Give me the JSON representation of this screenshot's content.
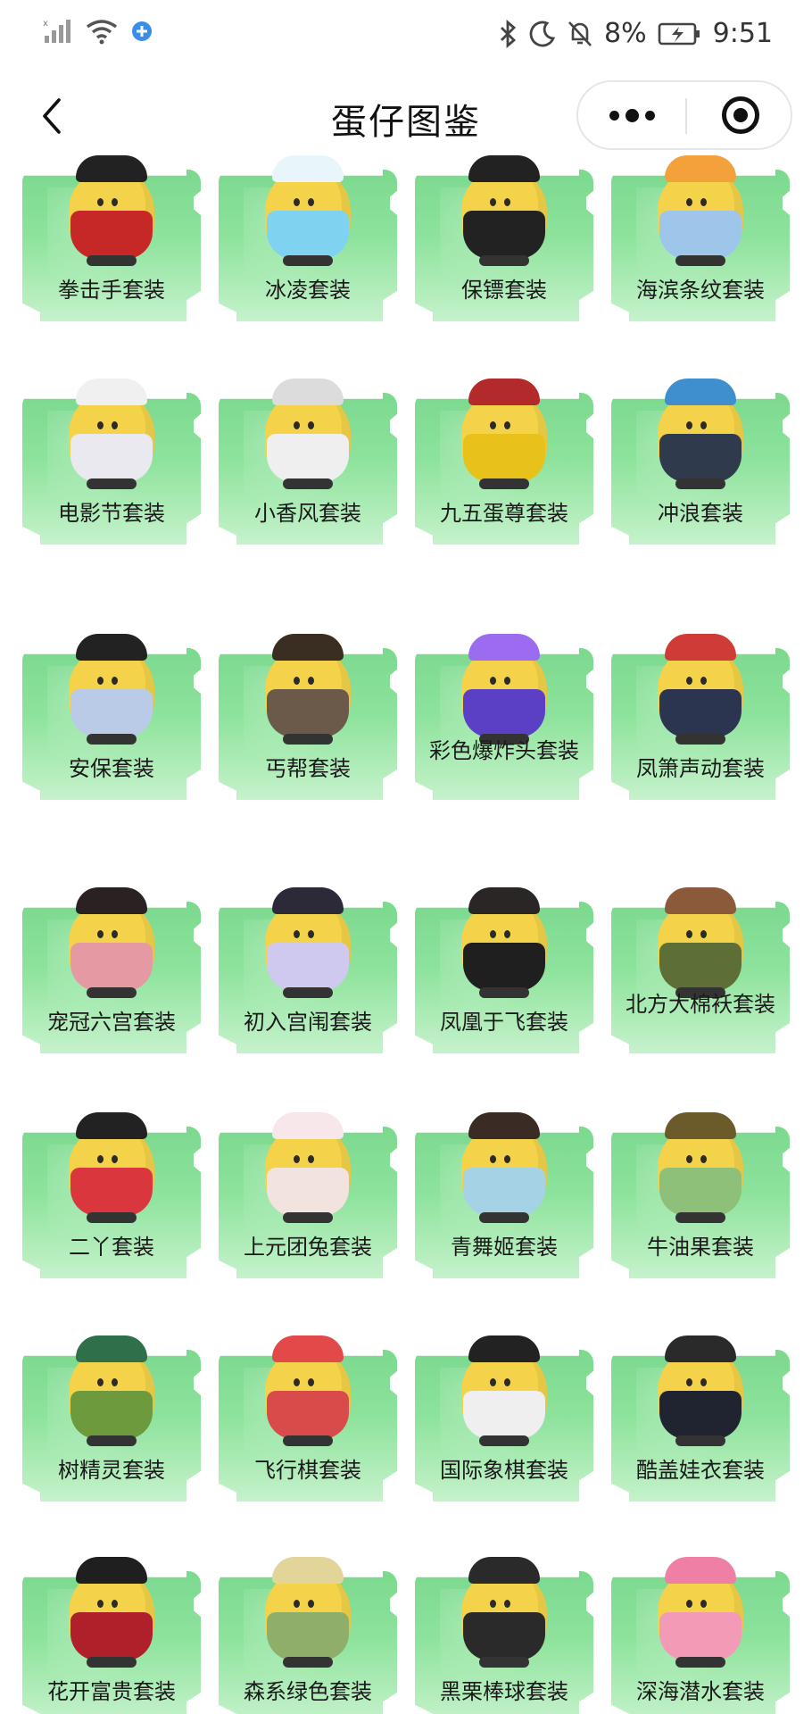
{
  "status_bar": {
    "battery": "8%",
    "time": "9:51"
  },
  "nav": {
    "title": "蛋仔图鉴"
  },
  "outfits": [
    {
      "name": "拳击手套装",
      "outfit": "#c62828",
      "hat": "#222222"
    },
    {
      "name": "冰凌套装",
      "outfit": "#7fd3f0",
      "hat": "#e8f6fb"
    },
    {
      "name": "保镖套装",
      "outfit": "#222222",
      "hat": "#222222"
    },
    {
      "name": "海滨条纹套装",
      "outfit": "#9ec6ea",
      "hat": "#f2a13b"
    },
    {
      "name": "电影节套装",
      "outfit": "#e9e9ef",
      "hat": "#f0f0f0"
    },
    {
      "name": "小香风套装",
      "outfit": "#efefef",
      "hat": "#dcdcdc"
    },
    {
      "name": "九五蛋尊套装",
      "outfit": "#e8c21a",
      "hat": "#b22a2a"
    },
    {
      "name": "冲浪套装",
      "outfit": "#2f3b4c",
      "hat": "#3f8fcf"
    },
    {
      "name": "安保套装",
      "outfit": "#b9cbe6",
      "hat": "#222222"
    },
    {
      "name": "丐帮套装",
      "outfit": "#6b5a49",
      "hat": "#3a2d22"
    },
    {
      "name": "彩色爆炸头套装",
      "outfit": "#5b3fc4",
      "hat": "#9b6cf0"
    },
    {
      "name": "凤箫声动套装",
      "outfit": "#2b3550",
      "hat": "#cf3b36"
    },
    {
      "name": "宠冠六宫套装",
      "outfit": "#e59aa3",
      "hat": "#2a2222"
    },
    {
      "name": "初入宫闱套装",
      "outfit": "#cfc9ef",
      "hat": "#2c2a38"
    },
    {
      "name": "凤凰于飞套装",
      "outfit": "#1f1f1f",
      "hat": "#2a2626"
    },
    {
      "name": "北方大棉袄套装",
      "outfit": "#5d6e36",
      "hat": "#8a5a3a"
    },
    {
      "name": "二丫套装",
      "outfit": "#d9363e",
      "hat": "#222222"
    },
    {
      "name": "上元团兔套装",
      "outfit": "#f2e3de",
      "hat": "#f7e7ea"
    },
    {
      "name": "青舞姬套装",
      "outfit": "#a6d2e6",
      "hat": "#3a2b24"
    },
    {
      "name": "牛油果套装",
      "outfit": "#8ec07a",
      "hat": "#6b5a2a"
    },
    {
      "name": "树精灵套装",
      "outfit": "#6d9a3c",
      "hat": "#2f6f4a"
    },
    {
      "name": "飞行棋套装",
      "outfit": "#d94b4b",
      "hat": "#e24a4a"
    },
    {
      "name": "国际象棋套装",
      "outfit": "#efefef",
      "hat": "#222222"
    },
    {
      "name": "酷盖娃衣套装",
      "outfit": "#1f2430",
      "hat": "#2a2a2a"
    },
    {
      "name": "花开富贵套装",
      "outfit": "#b0202a",
      "hat": "#1f1f1f"
    },
    {
      "name": "森系绿色套装",
      "outfit": "#8fae6a",
      "hat": "#e3d49a"
    },
    {
      "name": "黑栗棒球套装",
      "outfit": "#2a2a2a",
      "hat": "#2a2a2a"
    },
    {
      "name": "深海潜水套装",
      "outfit": "#f29ab6",
      "hat": "#f07fa5"
    }
  ]
}
